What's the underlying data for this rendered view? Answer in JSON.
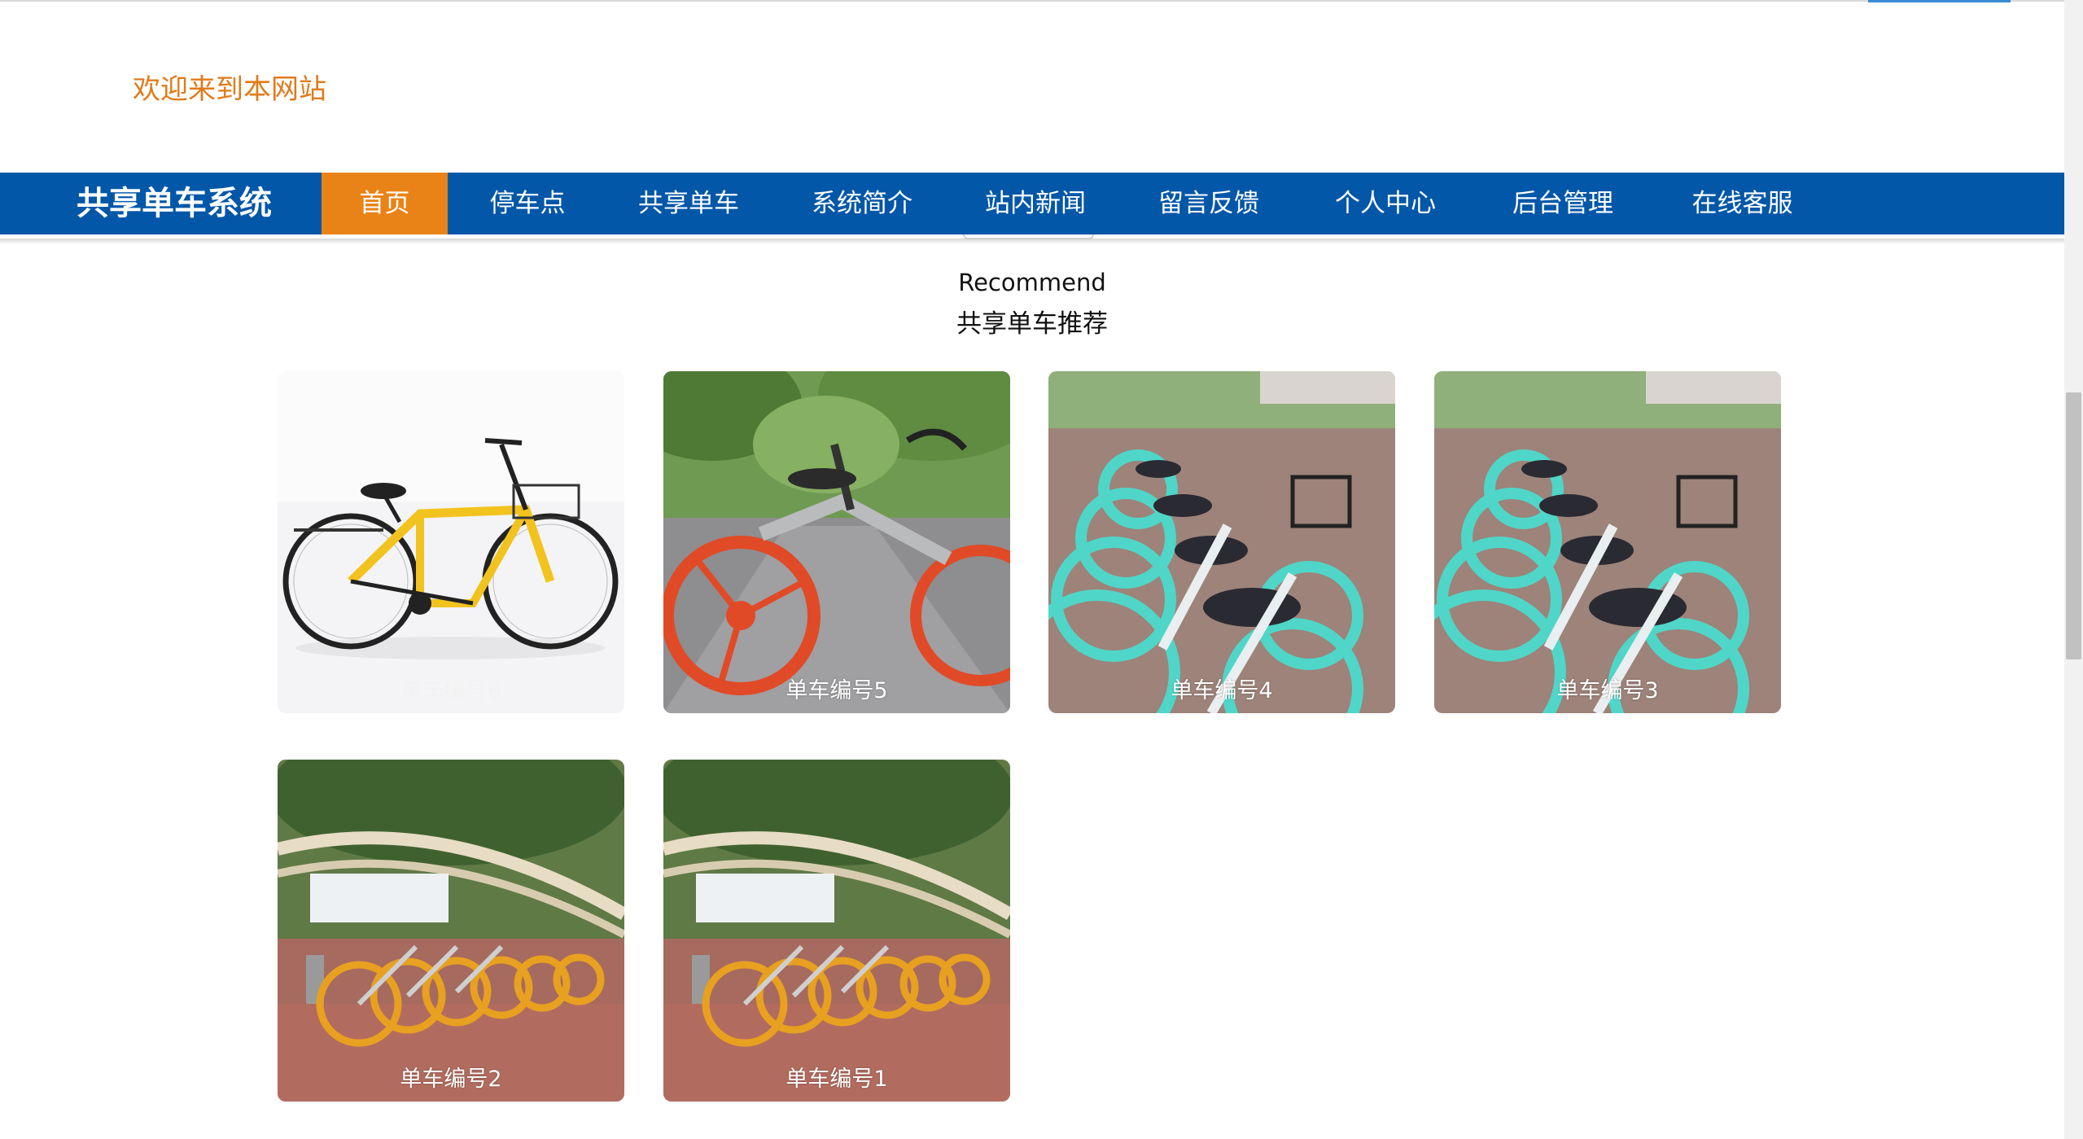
{
  "header": {
    "welcome": "欢迎来到本网站"
  },
  "nav": {
    "brand": "共享单车系统",
    "items": [
      {
        "label": "首页",
        "active": true
      },
      {
        "label": "停车点",
        "active": false
      },
      {
        "label": "共享单车",
        "active": false
      },
      {
        "label": "系统简介",
        "active": false
      },
      {
        "label": "站内新闻",
        "active": false
      },
      {
        "label": "留言反馈",
        "active": false
      },
      {
        "label": "个人中心",
        "active": false
      },
      {
        "label": "后台管理",
        "active": false
      },
      {
        "label": "在线客服",
        "active": false
      }
    ]
  },
  "recommend": {
    "title_en": "Recommend",
    "title_cn": "共享单车推荐",
    "cards": [
      {
        "label": "单车编号6"
      },
      {
        "label": "单车编号5"
      },
      {
        "label": "单车编号4"
      },
      {
        "label": "单车编号3"
      },
      {
        "label": "单车编号2"
      },
      {
        "label": "单车编号1"
      }
    ]
  },
  "colors": {
    "nav_bg": "#0357a8",
    "nav_active": "#e98317",
    "welcome_text": "#e07b1a"
  }
}
